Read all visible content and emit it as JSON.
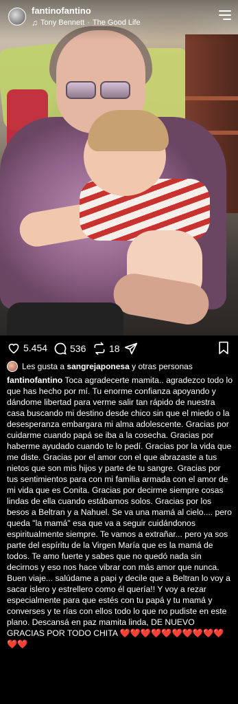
{
  "post": {
    "username": "fantinofantino",
    "music_artist": "Tony Bennett",
    "music_separator": "·",
    "music_title": "The Good Life"
  },
  "actions": {
    "likes": "5.454",
    "comments": "536",
    "reposts": "18"
  },
  "liked_by": {
    "prefix": "Les gusta a",
    "user": "sangrejaponesa",
    "suffix": "y otras personas"
  },
  "caption": {
    "author": "fantinofantino",
    "text": "Toca agradecerte mamita.. agradezco todo lo que has hecho por mí.  Tu enorme confianza apoyando y dándome libertad para verme salir tan rápido de nuestra casa buscando mi destino desde chico sin que el miedo o la desesperanza embargara mi alma adolescente. Gracias por cuidarme cuando papá se iba a la cosecha.  Gracias por haberme ayudado cuando te lo pedí.  Gracias por la vida que me diste.  Gracias por el amor con el que abrazaste a tus nietos que son mis hijos y parte de tu sangre.  Gracias por tus sentimientos para con mi familia armada con el amor de mi vida  que es Conita. Gracias por decirme siempre cosas lindas de ella cuando estábamos solos. Gracias por los besos a Beltran y a Nahuel.  Se va una mamá al cielo.... pero queda \"la mamá\"  esa que va a seguir cuidándonos espiritualmente siempre.  Te vamos a extrañar... pero ya sos parte del espíritu  de la Virgen María que es la mamá de todos.  Te amo fuerte y sabes que no quedó nada sin decirnos y eso nos hace vibrar con más amor que nunca.  Buen viaje... salúdame a papi y decile que a Beltran lo voy a sacar islero y estrellero como él quería!! Y voy a rezar especialmente para que estés con tu papá y tu mamá y converses y te rías con ellos todo lo que no pudiste en este plano. Descansá en paz mamita linda, DE NUEVO GRACIAS POR TODO CHITA",
    "hearts": "❤️❤️❤️❤️❤️❤️❤️❤️❤️❤️❤️❤️"
  },
  "colors": {
    "background": "#000000",
    "heart": "#e0243a"
  },
  "icons": {
    "music": "music-note-icon",
    "menu": "menu-icon",
    "like": "heart-icon",
    "comment": "comment-icon",
    "repost": "repost-icon",
    "share": "share-icon",
    "save": "bookmark-icon"
  }
}
